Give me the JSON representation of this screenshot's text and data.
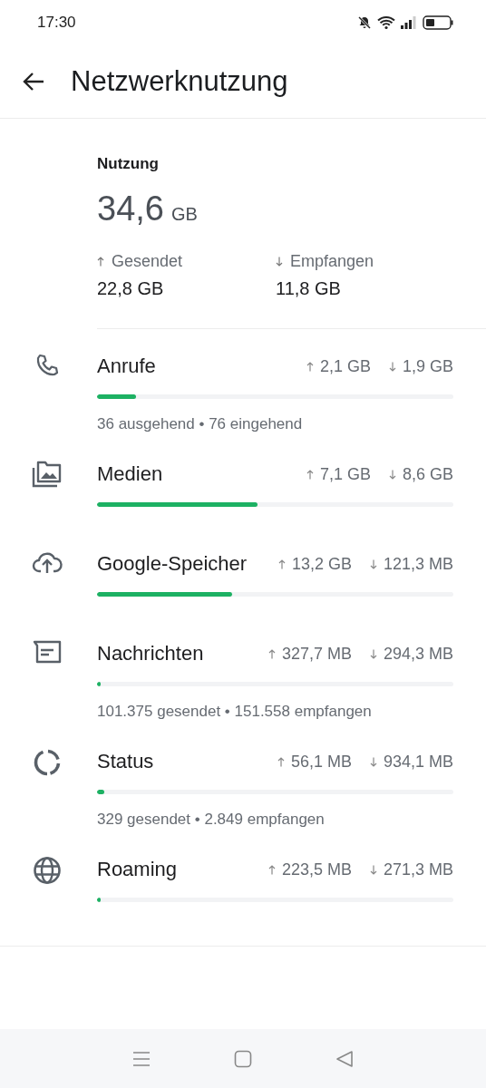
{
  "status_bar": {
    "time": "17:30"
  },
  "header": {
    "title": "Netzwerknutzung"
  },
  "summary": {
    "label": "Nutzung",
    "total": "34,6",
    "unit": "GB",
    "sent_label": "Gesendet",
    "sent": "22,8 GB",
    "received_label": "Empfangen",
    "received": "11,8 GB"
  },
  "categories": [
    {
      "kind": "phone",
      "name": "Anrufe",
      "sent": "2,1 GB",
      "received": "1,9 GB",
      "level": 0.11,
      "detail": "36 ausgehend • 76 eingehend"
    },
    {
      "kind": "media",
      "name": "Medien",
      "sent": "7,1 GB",
      "received": "8,6 GB",
      "level": 0.45
    },
    {
      "kind": "cloud",
      "name": "Google-Speicher",
      "sent": "13,2 GB",
      "received": "121,3 MB",
      "level": 0.38
    },
    {
      "kind": "message",
      "name": "Nachrichten",
      "sent": "327,7 MB",
      "received": "294,3 MB",
      "level": 0.01,
      "detail": "101.375 gesendet • 151.558 empfangen"
    },
    {
      "kind": "status",
      "name": "Status",
      "sent": "56,1 MB",
      "received": "934,1 MB",
      "level": 0.02,
      "detail": "329 gesendet • 2.849 empfangen"
    },
    {
      "kind": "globe",
      "name": "Roaming",
      "sent": "223,5 MB",
      "received": "271,3 MB",
      "level": 0.01
    }
  ]
}
